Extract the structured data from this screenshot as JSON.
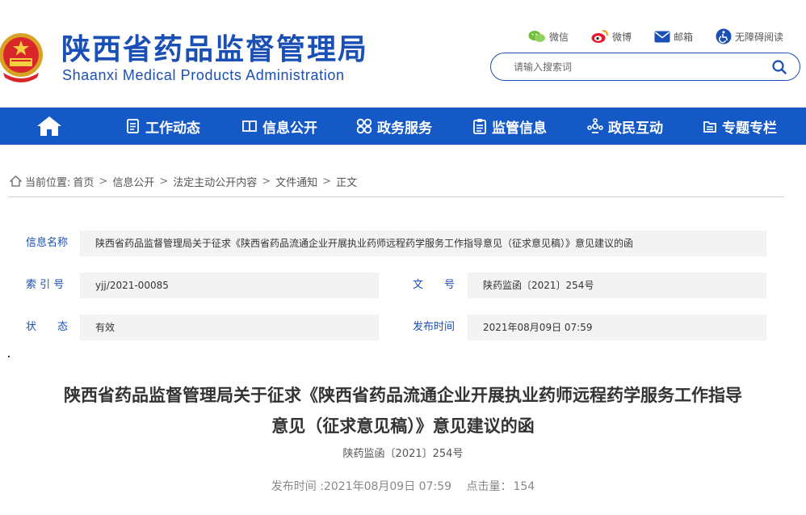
{
  "header": {
    "logo_cn": "陕西省药品监督管理局",
    "logo_en": "Shaanxi Medical Products Administration",
    "toplinks": [
      {
        "label": "微信",
        "icon": "wechat-icon"
      },
      {
        "label": "微博",
        "icon": "weibo-icon"
      },
      {
        "label": "邮箱",
        "icon": "mail-icon"
      },
      {
        "label": "无障碍阅读",
        "icon": "accessibility-icon"
      }
    ],
    "search_placeholder": "请输入搜索词"
  },
  "nav": {
    "items": [
      {
        "label": "工作动态",
        "icon": "document-list-icon"
      },
      {
        "label": "信息公开",
        "icon": "open-book-icon"
      },
      {
        "label": "政务服务",
        "icon": "grid-circles-icon"
      },
      {
        "label": "监管信息",
        "icon": "clipboard-icon"
      },
      {
        "label": "政民互动",
        "icon": "interaction-icon"
      },
      {
        "label": "专题专栏",
        "icon": "folder-icon"
      }
    ]
  },
  "breadcrumb": {
    "prefix": "当前位置:",
    "items": [
      "首页",
      "信息公开",
      "法定主动公开内容",
      "文件通知",
      "正文"
    ]
  },
  "info": {
    "name_label": "信息名称",
    "name_value": "陕西省药品监督管理局关于征求《陕西省药品流通企业开展执业药师远程药学服务工作指导意见（征求意见稿）》意见建议的函",
    "index_label": "索 引 号",
    "index_value": "yjj/2021-00085",
    "docno_label": "文　　号",
    "docno_value": "陕药监函〔2021〕254号",
    "status_label": "状　　态",
    "status_value": "有效",
    "date_label": "发布时间",
    "date_value": "2021年08月09日 07:59"
  },
  "article": {
    "title_line1": "陕西省药品监督管理局关于征求《陕西省药品流通企业开展执业药师远程药学服务工作指导",
    "title_line2": "意见（征求意见稿）》意见建议的函",
    "doc_no": "陕药监函〔2021〕254号",
    "publish_label": "发布时间 : ",
    "publish_time": "2021年08月09日 07:59",
    "clicks_label": "点击量：",
    "clicks": "154"
  },
  "colors": {
    "brand_blue": "#1a4fb5",
    "nav_blue": "#1559c6",
    "field_bg": "#f3f3f3"
  }
}
